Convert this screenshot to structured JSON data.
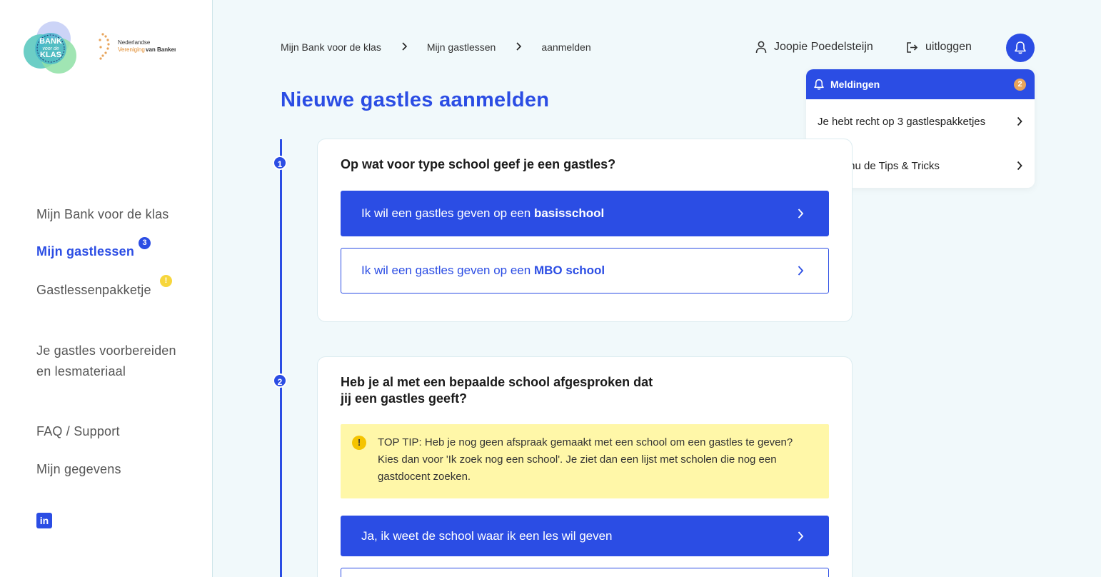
{
  "logos": {
    "bank_voor_de_klas": [
      "BANK",
      "voor de",
      "KLAS"
    ],
    "nvb": [
      "Nederlandse",
      "Vereniging",
      "van Banken"
    ]
  },
  "sidebar": {
    "items": [
      {
        "label": "Mijn Bank voor de klas"
      },
      {
        "label": "Mijn gastlessen",
        "badge": "3"
      },
      {
        "label": "Gastlessenpakketje",
        "badge": "!"
      },
      {
        "label": "Je gastles voorbereiden en lesmateriaal"
      },
      {
        "label": "FAQ / Support"
      },
      {
        "label": "Mijn gegevens"
      }
    ],
    "linkedin_label": "in"
  },
  "breadcrumb": [
    "Mijn Bank voor de klas",
    "Mijn gastlessen",
    "aanmelden"
  ],
  "header": {
    "user_name": "Joopie Poedelsteijn",
    "logout_label": "uitloggen"
  },
  "notifications": {
    "title": "Meldingen",
    "count": "2",
    "items": [
      "Je hebt recht op 3 gastlespakketjes",
      "Bekijk nu de Tips & Tricks"
    ]
  },
  "page_title": "Nieuwe gastles aanmelden",
  "step1": {
    "number": "1",
    "question": "Op wat voor type school geef je een gastles?",
    "option1_prefix": "Ik wil een gastles geven op een ",
    "option1_bold": "basisschool",
    "option2_prefix": "Ik wil een gastles geven op een ",
    "option2_bold": "MBO school"
  },
  "step2": {
    "number": "2",
    "question_line1": "Heb je al met een bepaalde school afgesproken dat",
    "question_line2": "jij een gastles geeft?",
    "tip_icon": "!",
    "tip_text": "TOP TIP: Heb je nog geen afspraak gemaakt met een school om een gastles te geven? Kies dan voor 'Ik zoek nog een school'. Je ziet dan een lijst met scholen die nog een gastdocent zoeken.",
    "option1": "Ja, ik weet de school waar ik een les wil geven"
  },
  "colors": {
    "primary": "#2b4de4",
    "background": "#f1f9fb",
    "tip_background": "#fff7a8",
    "notification_badge": "#e8a45a"
  }
}
